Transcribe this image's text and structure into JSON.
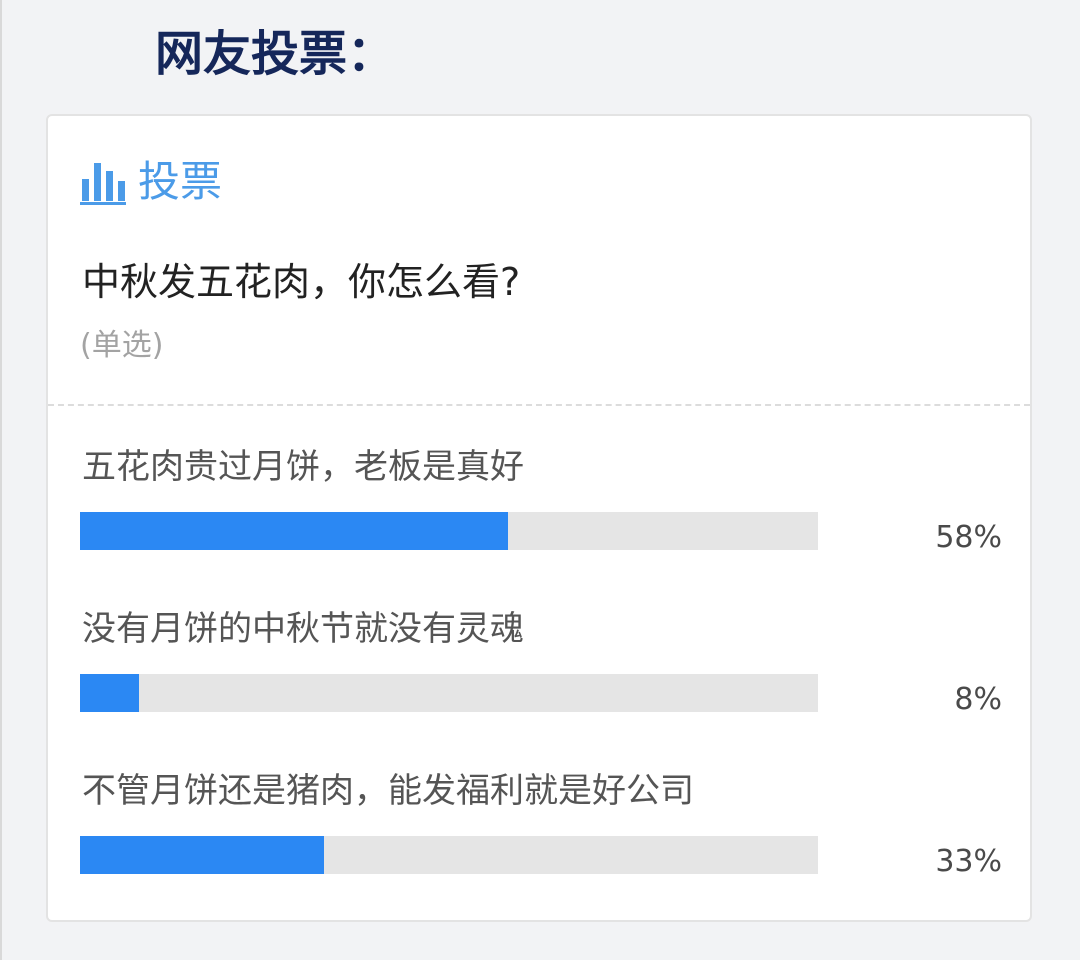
{
  "section_title": "网友投票：",
  "poll": {
    "header_label": "投票",
    "header_icon": "bar-chart-icon",
    "question": "中秋发五花肉，你怎么看?",
    "note": "(单选)",
    "accent_color": "#4b9be8",
    "bar_color": "#2b88f3",
    "options": [
      {
        "label": "五花肉贵过月饼，老板是真好",
        "percent_text": "58%",
        "value": 58
      },
      {
        "label": "没有月饼的中秋节就没有灵魂",
        "percent_text": "8%",
        "value": 8
      },
      {
        "label": "不管月饼还是猪肉，能发福利就是好公司",
        "percent_text": "33%",
        "value": 33
      }
    ]
  }
}
